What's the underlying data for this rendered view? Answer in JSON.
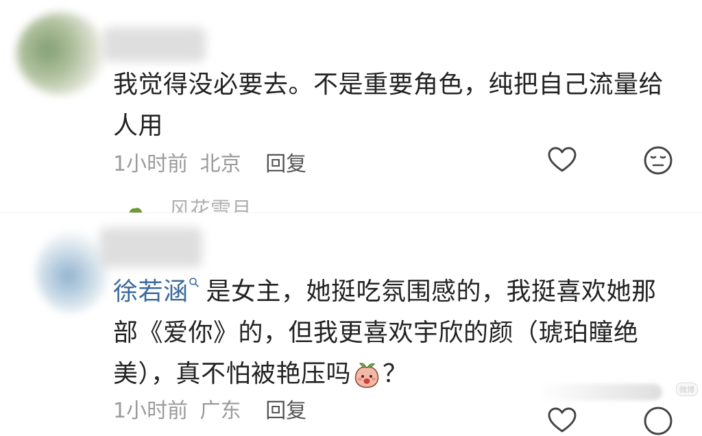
{
  "comments": [
    {
      "text": "我觉得没必要去。不是重要角色，纯把自己流量给人用",
      "time": "1小时前",
      "location": "北京",
      "reply_label": "回复"
    },
    {
      "mention": "徐若涵",
      "text": "是女主，她挺吃氛围感的，我挺喜欢她那部《爱你》的，但我更喜欢宇欣的颜（琥珀瞳绝美），真不怕被艳压吗",
      "text_end": "？",
      "time": "1小时前",
      "location": "广东",
      "reply_label": "回复"
    }
  ],
  "sub_reply": {
    "name": "风花雪月"
  },
  "watermark": "微博"
}
